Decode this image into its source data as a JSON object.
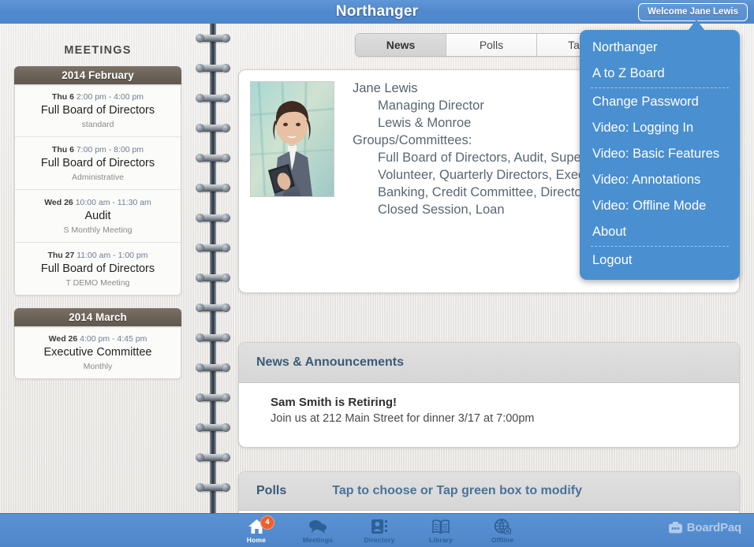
{
  "header": {
    "title": "Northanger",
    "welcome_button": "Welcome Jane Lewis"
  },
  "sidebar": {
    "title": "MEETINGS",
    "months": [
      {
        "label": "2014 February",
        "meetings": [
          {
            "day": "Thu 6",
            "time": "2:00 pm - 4:00 pm",
            "title": "Full Board of Directors",
            "subtitle": "standard"
          },
          {
            "day": "Thu 6",
            "time": "7:00 pm - 8:00 pm",
            "title": "Full Board of Directors",
            "subtitle": "Administrative"
          },
          {
            "day": "Wed 26",
            "time": "10:00 am - 11:30 am",
            "title": "Audit",
            "subtitle": "S Monthly Meeting"
          },
          {
            "day": "Thu 27",
            "time": "11:00 am - 1:00 pm",
            "title": "Full Board of Directors",
            "subtitle": "T DEMO Meeting"
          }
        ]
      },
      {
        "label": "2014 March",
        "meetings": [
          {
            "day": "Wed 26",
            "time": "4:00 pm - 4:45 pm",
            "title": "Executive Committee",
            "subtitle": "Monthly"
          }
        ]
      }
    ]
  },
  "tabs": [
    {
      "label": "News",
      "active": true
    },
    {
      "label": "Polls",
      "active": false
    },
    {
      "label": "Tasks",
      "active": false
    }
  ],
  "profile": {
    "name": "Jane Lewis",
    "role": "Managing Director",
    "company": "Lewis & Monroe",
    "groups_label": "Groups/Committees:",
    "groups": "Full Board of Directors, Audit, Supervisory Committee, Volunteer, Quarterly Directors, Executive Committee, Banking, Credit Committee, Directors, Catering/Events, Closed Session, Loan"
  },
  "news": {
    "header": "News & Announcements",
    "items": [
      {
        "title": "Sam Smith is Retiring!",
        "text": "Join us at 212 Main Street for dinner 3/17 at 7:00pm"
      }
    ]
  },
  "polls": {
    "label": "Polls",
    "hint": "Tap to choose or Tap green box to modify"
  },
  "dropdown": {
    "items": [
      {
        "label": "Northanger",
        "separator_after": false
      },
      {
        "label": "A to Z Board",
        "separator_after": true
      },
      {
        "label": "Change Password",
        "separator_after": false
      },
      {
        "label": "Video: Logging In",
        "separator_after": false
      },
      {
        "label": "Video: Basic Features",
        "separator_after": false
      },
      {
        "label": "Video: Annotations",
        "separator_after": false
      },
      {
        "label": "Video: Offline Mode",
        "separator_after": false
      },
      {
        "label": "About",
        "separator_after": true
      },
      {
        "label": "Logout",
        "separator_after": false
      }
    ]
  },
  "bottom_nav": {
    "items": [
      {
        "label": "Home",
        "icon": "home-icon",
        "active": true,
        "badge": "4"
      },
      {
        "label": "Meetings",
        "icon": "chat-bubbles-icon",
        "active": false,
        "badge": ""
      },
      {
        "label": "Directory",
        "icon": "contact-card-icon",
        "active": false,
        "badge": ""
      },
      {
        "label": "Library",
        "icon": "open-book-icon",
        "active": false,
        "badge": ""
      },
      {
        "label": "Offline",
        "icon": "globe-offline-icon",
        "active": false,
        "badge": ""
      }
    ],
    "brand": "BoardPaq"
  },
  "colors": {
    "header_blue": "#5189cd",
    "dropdown_blue": "#4a8fd0",
    "month_brown": "#6a6157",
    "accent_orange": "#e8622a",
    "heading_slate": "#3c5a78"
  }
}
